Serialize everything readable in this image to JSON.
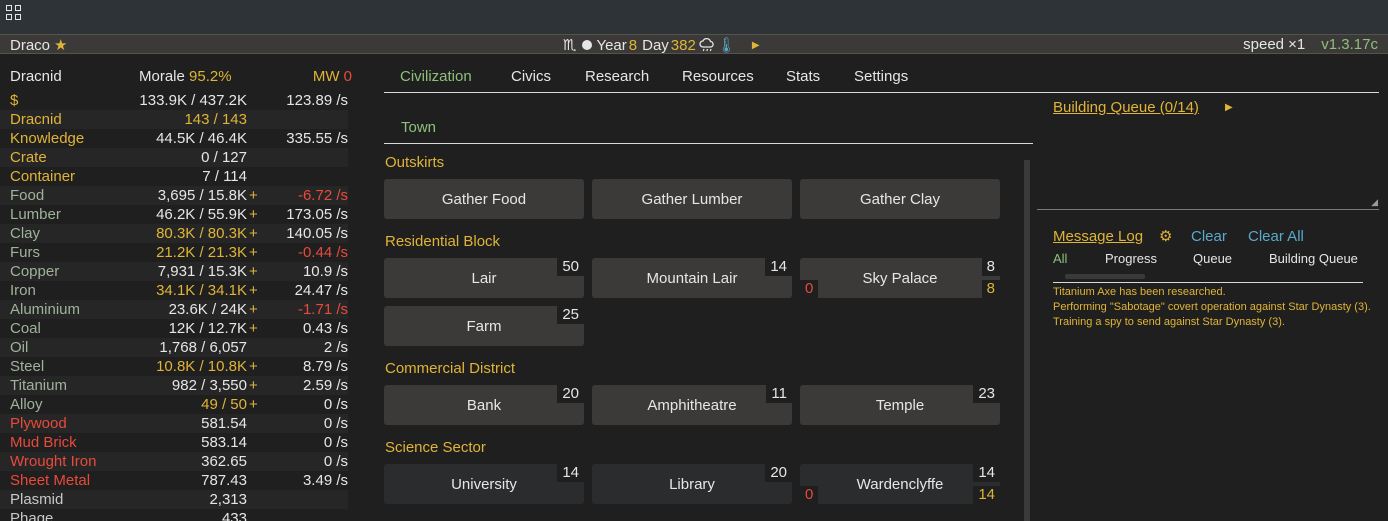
{
  "status": {
    "name": "Draco",
    "zodiac": "♏",
    "year_label": "Year",
    "year": "8",
    "day_label": "Day",
    "day": "382",
    "speed": "speed ×1",
    "version": "v1.3.17c"
  },
  "race": {
    "name": "Dracnid",
    "morale_label": "Morale",
    "morale": "95.2%",
    "mw_label": "MW",
    "mw": "0"
  },
  "resources": [
    {
      "name": "$",
      "amount": "133.9K / 437.2K",
      "plus": "",
      "rate": "123.89 /s",
      "name_color": "yellow",
      "amount_color": "white",
      "rate_color": "white"
    },
    {
      "name": "Dracnid",
      "amount": "143 / 143",
      "plus": "",
      "rate": "",
      "name_color": "yellow",
      "amount_color": "yellow",
      "rate_color": "white"
    },
    {
      "name": "Knowledge",
      "amount": "44.5K / 46.4K",
      "plus": "",
      "rate": "335.55 /s",
      "name_color": "yellow",
      "amount_color": "white",
      "rate_color": "white"
    },
    {
      "name": "Crate",
      "amount": "0 / 127",
      "plus": "",
      "rate": "",
      "name_color": "yellow",
      "amount_color": "white",
      "rate_color": "white"
    },
    {
      "name": "Container",
      "amount": "7 / 114",
      "plus": "",
      "rate": "",
      "name_color": "yellow",
      "amount_color": "white",
      "rate_color": "white"
    },
    {
      "name": "Food",
      "amount": "3,695 / 15.8K",
      "plus": "+",
      "rate": "-6.72 /s",
      "name_color": "green",
      "amount_color": "white",
      "rate_color": "red"
    },
    {
      "name": "Lumber",
      "amount": "46.2K / 55.9K",
      "plus": "+",
      "rate": "173.05 /s",
      "name_color": "green",
      "amount_color": "white",
      "rate_color": "white"
    },
    {
      "name": "Clay",
      "amount": "80.3K / 80.3K",
      "plus": "+",
      "rate": "140.05 /s",
      "name_color": "green",
      "amount_color": "yellow",
      "rate_color": "white"
    },
    {
      "name": "Furs",
      "amount": "21.2K / 21.3K",
      "plus": "+",
      "rate": "-0.44 /s",
      "name_color": "green",
      "amount_color": "yellow",
      "rate_color": "red"
    },
    {
      "name": "Copper",
      "amount": "7,931 / 15.3K",
      "plus": "+",
      "rate": "10.9 /s",
      "name_color": "green",
      "amount_color": "white",
      "rate_color": "white"
    },
    {
      "name": "Iron",
      "amount": "34.1K / 34.1K",
      "plus": "+",
      "rate": "24.47 /s",
      "name_color": "green",
      "amount_color": "yellow",
      "rate_color": "white"
    },
    {
      "name": "Aluminium",
      "amount": "23.6K / 24K",
      "plus": "+",
      "rate": "-1.71 /s",
      "name_color": "green",
      "amount_color": "white",
      "rate_color": "red"
    },
    {
      "name": "Coal",
      "amount": "12K / 12.7K",
      "plus": "+",
      "rate": "0.43 /s",
      "name_color": "green",
      "amount_color": "white",
      "rate_color": "white"
    },
    {
      "name": "Oil",
      "amount": "1,768 / 6,057",
      "plus": "",
      "rate": "2 /s",
      "name_color": "green",
      "amount_color": "white",
      "rate_color": "white"
    },
    {
      "name": "Steel",
      "amount": "10.8K / 10.8K",
      "plus": "+",
      "rate": "8.79 /s",
      "name_color": "green",
      "amount_color": "yellow",
      "rate_color": "white"
    },
    {
      "name": "Titanium",
      "amount": "982 / 3,550",
      "plus": "+",
      "rate": "2.59 /s",
      "name_color": "green",
      "amount_color": "white",
      "rate_color": "white"
    },
    {
      "name": "Alloy",
      "amount": "49 / 50",
      "plus": "+",
      "rate": "0 /s",
      "name_color": "green",
      "amount_color": "yellow",
      "rate_color": "white"
    },
    {
      "name": "Plywood",
      "amount": "581.54",
      "plus": "",
      "rate": "0 /s",
      "name_color": "red",
      "amount_color": "white",
      "rate_color": "white"
    },
    {
      "name": "Mud Brick",
      "amount": "583.14",
      "plus": "",
      "rate": "0 /s",
      "name_color": "red",
      "amount_color": "white",
      "rate_color": "white"
    },
    {
      "name": "Wrought Iron",
      "amount": "362.65",
      "plus": "",
      "rate": "0 /s",
      "name_color": "red",
      "amount_color": "white",
      "rate_color": "white"
    },
    {
      "name": "Sheet Metal",
      "amount": "787.43",
      "plus": "",
      "rate": "3.49 /s",
      "name_color": "red",
      "amount_color": "white",
      "rate_color": "white"
    },
    {
      "name": "Plasmid",
      "amount": "2,313",
      "plus": "",
      "rate": "",
      "name_color": "gray",
      "amount_color": "white",
      "rate_color": "white"
    },
    {
      "name": "Phage",
      "amount": "433",
      "plus": "",
      "rate": "",
      "name_color": "gray",
      "amount_color": "white",
      "rate_color": "white"
    }
  ],
  "tabs": [
    "Civilization",
    "Civics",
    "Research",
    "Resources",
    "Stats",
    "Settings"
  ],
  "subtab": "Town",
  "sections": {
    "outskirts": "Outskirts",
    "residential": "Residential Block",
    "commercial": "Commercial District",
    "science": "Science Sector"
  },
  "buildings": {
    "gather_food": "Gather Food",
    "gather_lumber": "Gather Lumber",
    "gather_clay": "Gather Clay",
    "lair": {
      "label": "Lair",
      "count": "50"
    },
    "mountain_lair": {
      "label": "Mountain Lair",
      "count": "14"
    },
    "sky_palace": {
      "label": "Sky Palace",
      "count": "8",
      "off": "0",
      "on": "8"
    },
    "farm": {
      "label": "Farm",
      "count": "25"
    },
    "bank": {
      "label": "Bank",
      "count": "20"
    },
    "amphitheatre": {
      "label": "Amphitheatre",
      "count": "11"
    },
    "temple": {
      "label": "Temple",
      "count": "23"
    },
    "university": {
      "label": "University",
      "count": "14"
    },
    "library": {
      "label": "Library",
      "count": "20"
    },
    "wardenclyffe": {
      "label": "Wardenclyffe",
      "count": "14",
      "off": "0",
      "on": "14"
    }
  },
  "queue": {
    "title": "Building Queue (0/14)"
  },
  "log": {
    "title": "Message Log",
    "clear": "Clear",
    "clear_all": "Clear All",
    "filters": [
      "All",
      "Progress",
      "Queue",
      "Building Queue"
    ],
    "messages": [
      "Titanium Axe has been researched.",
      "Performing \"Sabotage\" covert operation against Star Dynasty (3).",
      "Training a spy to send against Star Dynasty (3)."
    ]
  },
  "icons": {
    "menu": "grid-icon",
    "star": "star-icon",
    "moon": "moon-icon",
    "weather": "cloud-rain-icon",
    "temperature": "thermometer-icon",
    "play": "play-icon",
    "gear": "gear-icon"
  }
}
